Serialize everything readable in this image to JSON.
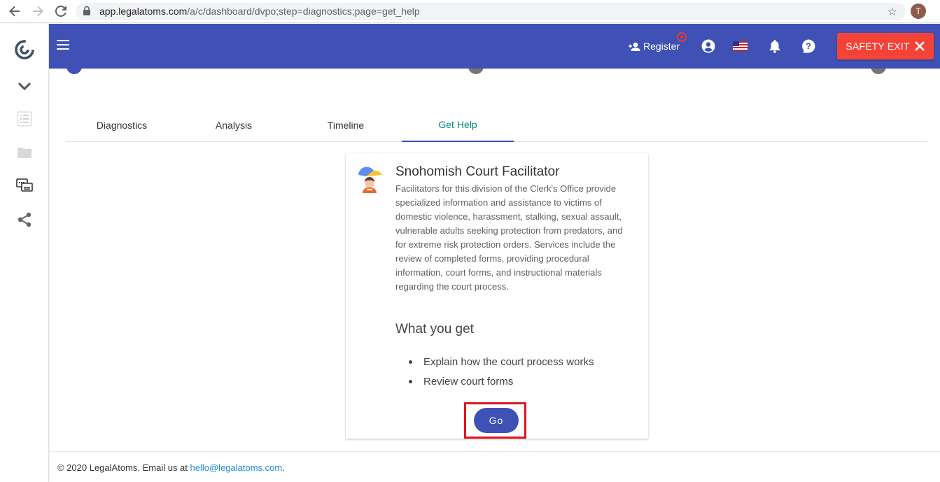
{
  "browser": {
    "url_host": "app.legalatoms.com",
    "url_path": "/a/c/dashboard/dvpo;step=diagnostics;page=get_help",
    "profile_initial": "T"
  },
  "header": {
    "register_label": "Register",
    "safety_exit_label": "SAFETY EXIT",
    "color": "#3f51b5",
    "safety_color": "#f44336"
  },
  "rail": {
    "items": [
      "logo-icon",
      "chevron-down-icon",
      "list-icon",
      "folder-icon",
      "chat-icon",
      "share-icon"
    ]
  },
  "tabs": [
    {
      "label": "Diagnostics",
      "active": false
    },
    {
      "label": "Analysis",
      "active": false
    },
    {
      "label": "Timeline",
      "active": false
    },
    {
      "label": "Get Help",
      "active": true
    }
  ],
  "card": {
    "title": "Snohomish Court Facilitator",
    "description": "Facilitators for this division of the Clerk's Office provide specialized information and assistance to victims of domestic violence, harassment, stalking, sexual assault, vulnerable adults seeking protection from predators, and for extreme risk protection orders. Services include the review of completed forms, providing procedural information, court forms, and instructional materials regarding the court process.",
    "subheading": "What you get",
    "benefits": [
      "Explain how the court process works",
      "Review court forms"
    ],
    "go_label": "Go"
  },
  "footer": {
    "copyright": "© 2020 LegalAtoms.  Email us at ",
    "email": "hello@legalatoms.com",
    "period": "."
  }
}
